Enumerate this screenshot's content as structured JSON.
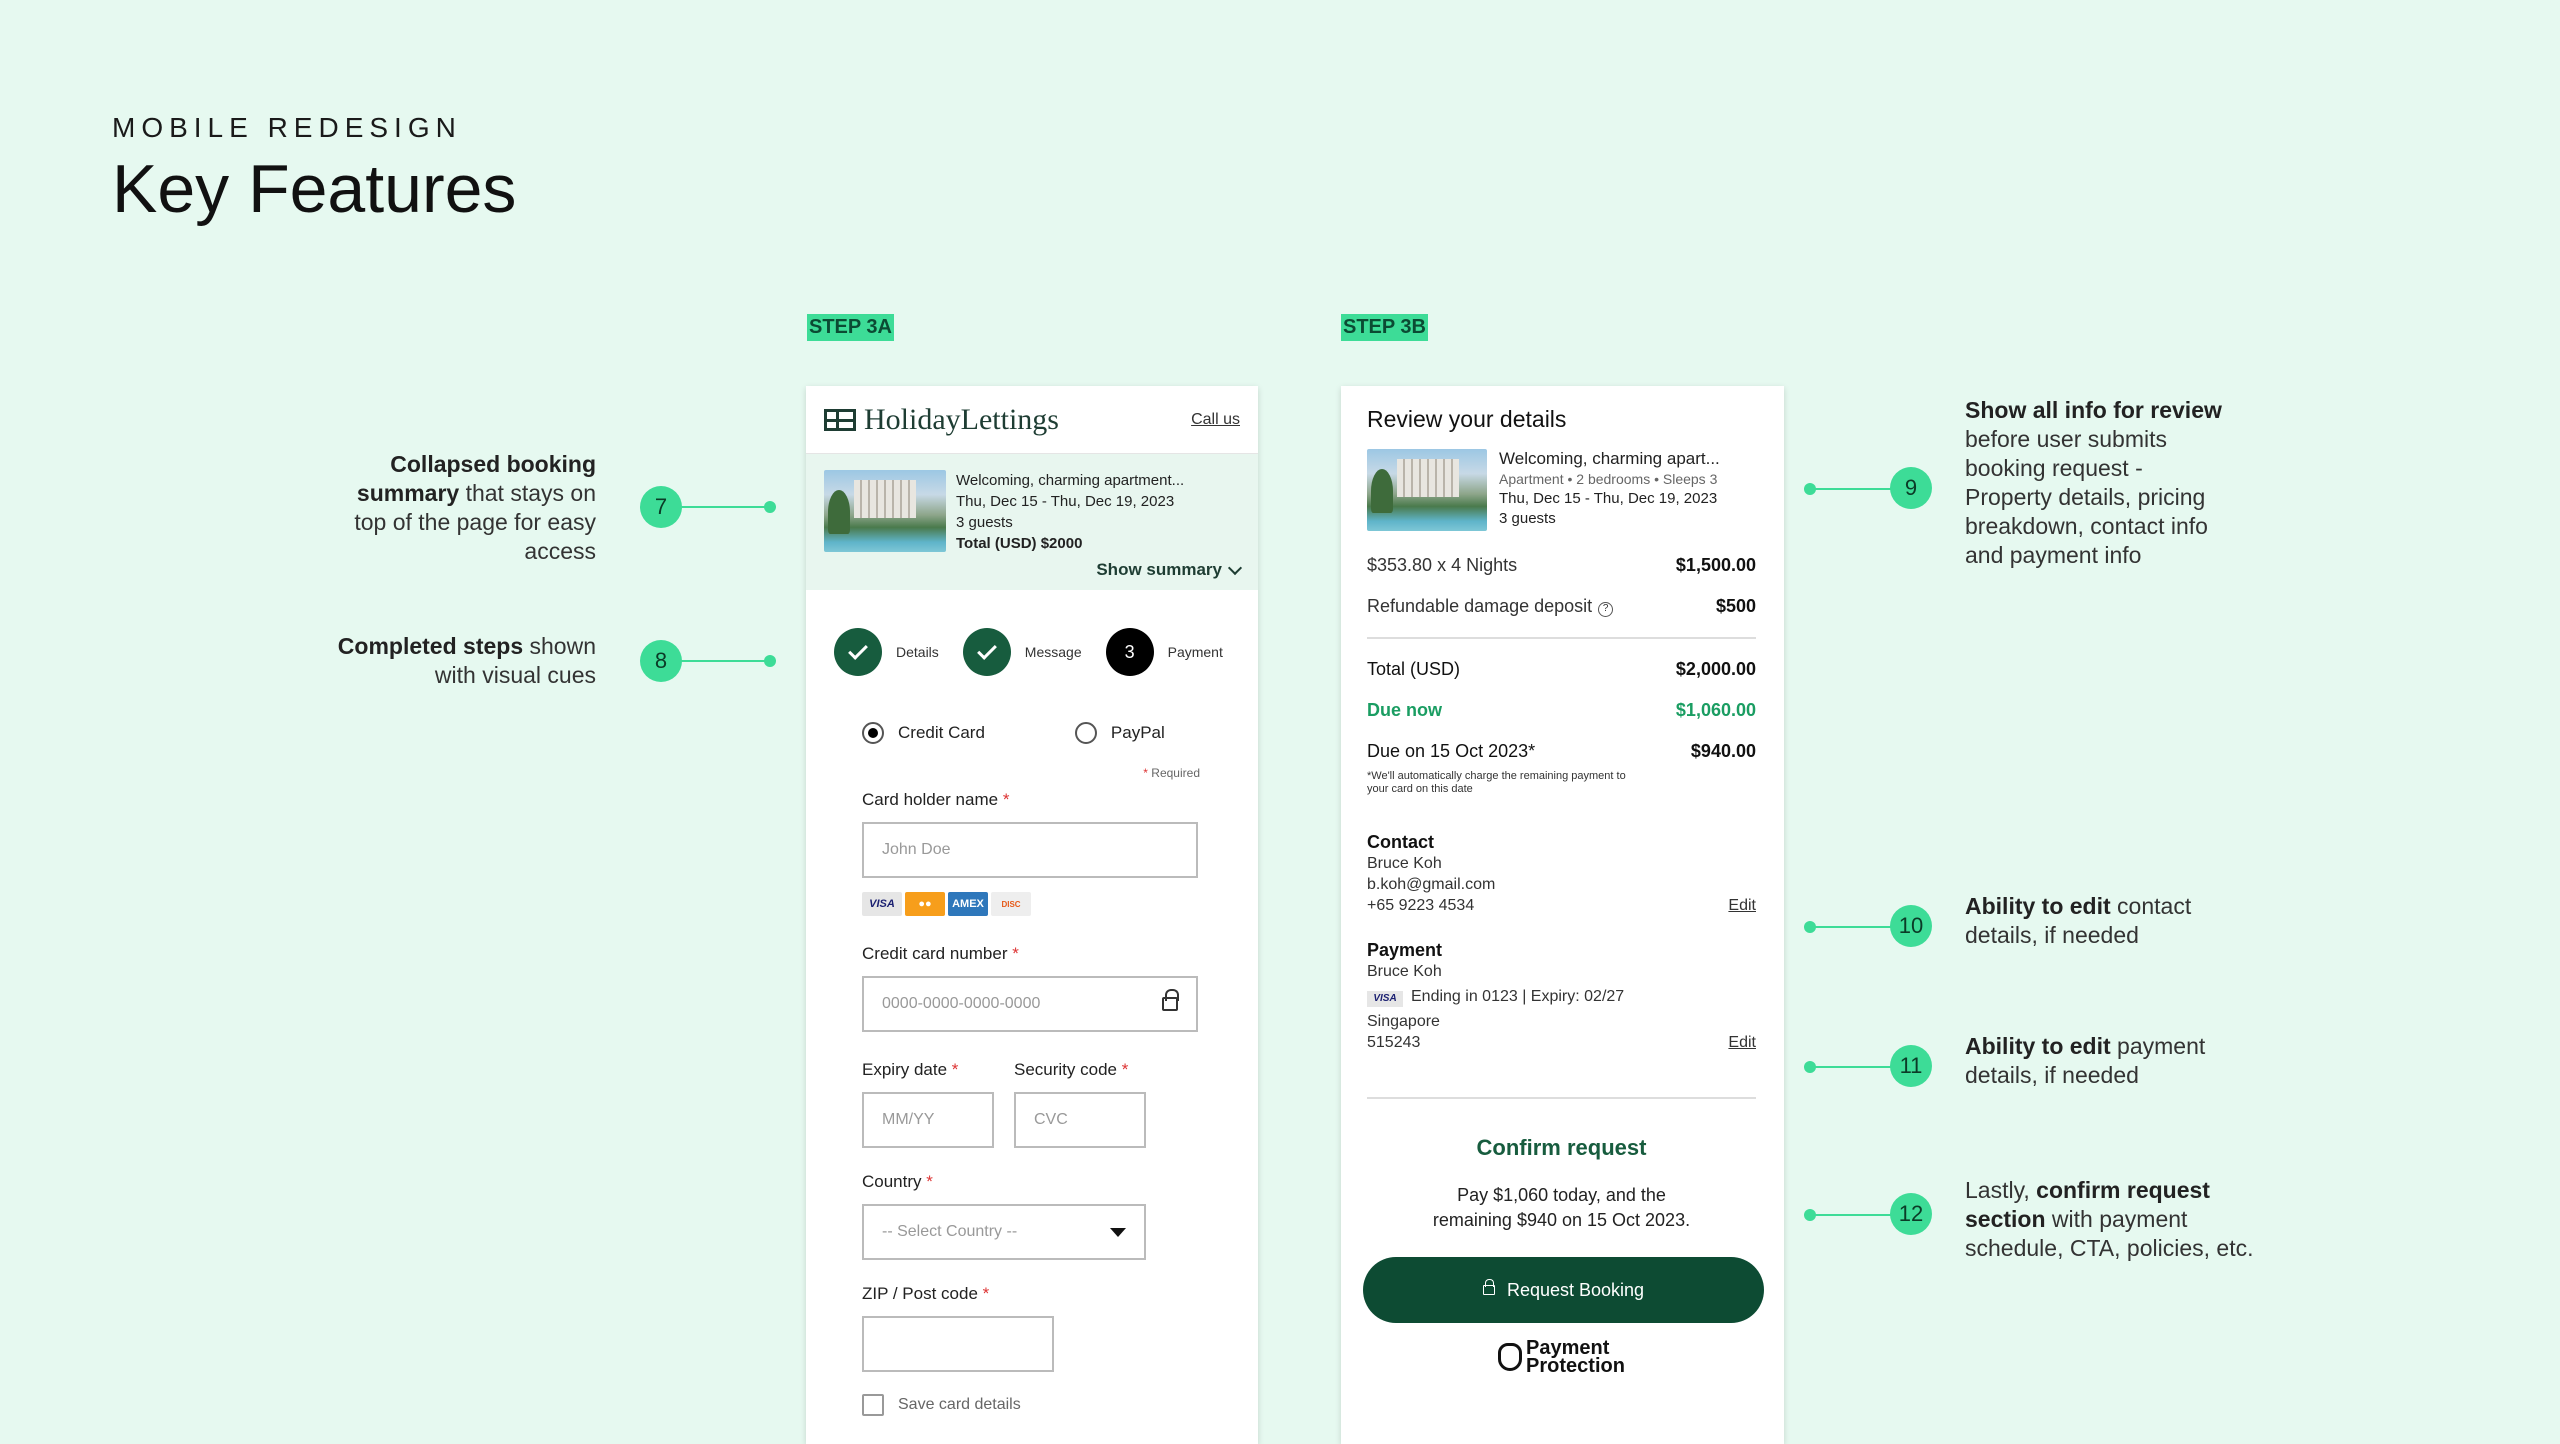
{
  "header": {
    "eyebrow": "MOBILE  REDESIGN",
    "title": "Key Features"
  },
  "step_tags": {
    "a": "STEP 3A",
    "b": "STEP 3B"
  },
  "step3a": {
    "brand": "HolidayLettings",
    "call_us": "Call us",
    "summary": {
      "title": "Welcoming, charming apartment...",
      "dates": "Thu, Dec 15 - Thu, Dec 19, 2023",
      "guests": "3 guests",
      "total": "Total (USD)  $2000",
      "show": "Show summary"
    },
    "steps": [
      {
        "label": "Details"
      },
      {
        "label": "Message"
      },
      {
        "label": "Payment",
        "num": "3"
      }
    ],
    "pay_options": {
      "credit": "Credit Card",
      "paypal": "PayPal"
    },
    "required": "Required",
    "fields": {
      "holder_label": "Card holder name",
      "holder_ph": "John Doe",
      "number_label": "Credit card number",
      "number_ph": "0000-0000-0000-0000",
      "expiry_label": "Expiry date",
      "expiry_ph": "MM/YY",
      "cvc_label": "Security code",
      "cvc_ph": "CVC",
      "country_label": "Country",
      "country_value": "-- Select Country --",
      "zip_label": "ZIP / Post code",
      "save": "Save card details"
    },
    "cards": [
      "VISA",
      "MC",
      "AMEX",
      "DISCOVER"
    ]
  },
  "step3b": {
    "heading": "Review your details",
    "property": {
      "title": "Welcoming, charming apart...",
      "meta": "Apartment • 2 bedrooms • Sleeps 3",
      "dates": "Thu, Dec 15 - Thu, Dec 19, 2023",
      "guests": "3 guests"
    },
    "price": {
      "nights_label": "$353.80 x 4 Nights",
      "nights_value": "$1,500.00",
      "deposit_label": "Refundable damage deposit",
      "deposit_value": "$500",
      "total_label": "Total (USD)",
      "total_value": "$2,000.00",
      "due_label": "Due now",
      "due_value": "$1,060.00",
      "later_label": "Due on 15 Oct 2023*",
      "later_value": "$940.00",
      "note": "*We'll automatically charge the remaining payment to your card on this date"
    },
    "contact": {
      "heading": "Contact",
      "name": "Bruce Koh",
      "email": "b.koh@gmail.com",
      "phone": "+65 9223 4534",
      "edit": "Edit"
    },
    "payment": {
      "heading": "Payment",
      "name": "Bruce Koh",
      "card": "Ending in 0123  |  Expiry: 02/27",
      "country": "Singapore",
      "zip": "515243",
      "edit": "Edit"
    },
    "confirm": {
      "heading": "Confirm request",
      "desc1": "Pay $1,060 today, and the",
      "desc2": "remaining $940 on 15 Oct 2023.",
      "button": "Request Booking",
      "protection1": "Payment",
      "protection2": "Protection"
    }
  },
  "annotations": {
    "n7": {
      "num": "7",
      "bold": "Collapsed booking summary",
      "rest": " that stays on top of the page for easy access"
    },
    "n8": {
      "num": "8",
      "bold": "Completed steps",
      "rest": " shown with visual cues"
    },
    "n9": {
      "num": "9",
      "bold": "Show all info for review",
      "rest": " before user submits booking request - Property details, pricing breakdown, contact info and payment info"
    },
    "n10": {
      "num": "10",
      "bold": "Ability to edit",
      "rest": " contact details, if needed"
    },
    "n11": {
      "num": "11",
      "bold": "Ability to edit",
      "rest": " payment details, if needed"
    },
    "n12": {
      "num": "12",
      "pre": "Lastly, ",
      "bold": "confirm request section",
      "rest": " with payment schedule, CTA, policies, etc."
    }
  },
  "colors": {
    "background": "#e6f9f0",
    "accent": "#3ddc97",
    "brand_dark": "#0d4b33",
    "due_green": "#1a9d62"
  }
}
